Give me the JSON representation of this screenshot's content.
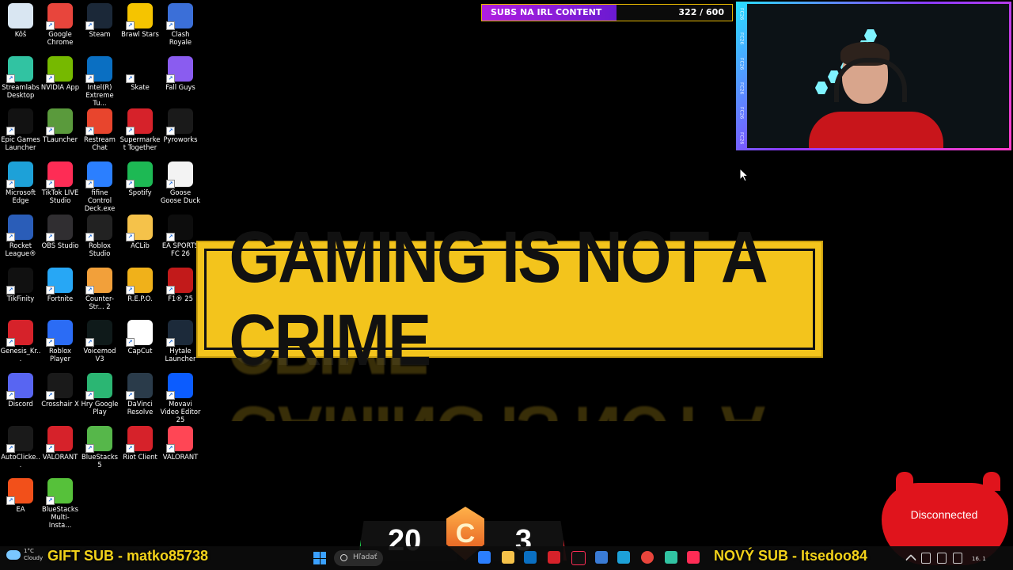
{
  "desktop": {
    "icons": [
      {
        "label": "Kôš",
        "icon": "recycle-bin-icon",
        "color": "#d9e6f2"
      },
      {
        "label": "Google Chrome",
        "icon": "chrome-icon",
        "color": "#e8453c"
      },
      {
        "label": "Steam",
        "icon": "steam-icon",
        "color": "#1b2838"
      },
      {
        "label": "Brawl Stars",
        "icon": "brawl-stars-icon",
        "color": "#f5c400"
      },
      {
        "label": "Clash Royale",
        "icon": "clash-royale-icon",
        "color": "#3b6fd8"
      },
      {
        "label": "Streamlabs Desktop",
        "icon": "streamlabs-icon",
        "color": "#31c3a2"
      },
      {
        "label": "NVIDIA App",
        "icon": "nvidia-icon",
        "color": "#76b900"
      },
      {
        "label": "Intel(R) Extreme Tu...",
        "icon": "intel-icon",
        "color": "#0a6fc2"
      },
      {
        "label": "Skate",
        "icon": "skate-icon",
        "color": "#000000"
      },
      {
        "label": "Fall Guys",
        "icon": "fall-guys-icon",
        "color": "#8a5cf0"
      },
      {
        "label": "Epic Games Launcher",
        "icon": "epic-games-icon",
        "color": "#121212"
      },
      {
        "label": "TLauncher",
        "icon": "tlauncher-icon",
        "color": "#5a9a3c"
      },
      {
        "label": "Restream Chat",
        "icon": "restream-icon",
        "color": "#e8452d"
      },
      {
        "label": "Supermarket Together",
        "icon": "supermarket-icon",
        "color": "#d6222a"
      },
      {
        "label": "Pyroworks",
        "icon": "pyroworks-icon",
        "color": "#1a1a1a"
      },
      {
        "label": "Microsoft Edge",
        "icon": "edge-icon",
        "color": "#1da1d8"
      },
      {
        "label": "TikTok LIVE Studio",
        "icon": "tiktok-live-icon",
        "color": "#fe2c55"
      },
      {
        "label": "fifine Control Deck.exe",
        "icon": "fifine-icon",
        "color": "#2b7fff"
      },
      {
        "label": "Spotify",
        "icon": "spotify-icon",
        "color": "#1db954"
      },
      {
        "label": "Goose Goose Duck",
        "icon": "goose-icon",
        "color": "#f3f3f3"
      },
      {
        "label": "Rocket League®",
        "icon": "rocket-league-icon",
        "color": "#2a5db8"
      },
      {
        "label": "OBS Studio",
        "icon": "obs-icon",
        "color": "#302e31"
      },
      {
        "label": "Roblox Studio",
        "icon": "roblox-studio-icon",
        "color": "#222222"
      },
      {
        "label": "ACLib",
        "icon": "folder-icon",
        "color": "#f5c24a"
      },
      {
        "label": "EA SPORTS FC 26",
        "icon": "fc26-icon",
        "color": "#0d0d0d"
      },
      {
        "label": "TikFinity",
        "icon": "tikfinity-icon",
        "color": "#111111"
      },
      {
        "label": "Fortnite",
        "icon": "fortnite-icon",
        "color": "#27a7f5"
      },
      {
        "label": "Counter-Str... 2",
        "icon": "cs2-icon",
        "color": "#f2a03a"
      },
      {
        "label": "R.E.P.O.",
        "icon": "repo-icon",
        "color": "#f0b11a"
      },
      {
        "label": "F1® 25",
        "icon": "f1-icon",
        "color": "#c21a1a"
      },
      {
        "label": "Genesis_Kr...",
        "icon": "genesis-icon",
        "color": "#d6222a"
      },
      {
        "label": "Roblox Player",
        "icon": "roblox-icon",
        "color": "#2b6cf5"
      },
      {
        "label": "Voicemod V3",
        "icon": "voicemod-icon",
        "color": "#0f1a1a"
      },
      {
        "label": "CapCut",
        "icon": "capcut-icon",
        "color": "#ffffff"
      },
      {
        "label": "Hytale Launcher",
        "icon": "hytale-icon",
        "color": "#1c2a3a"
      },
      {
        "label": "Discord",
        "icon": "discord-icon",
        "color": "#5865f2"
      },
      {
        "label": "Crosshair X",
        "icon": "crosshair-icon",
        "color": "#1a1a1a"
      },
      {
        "label": "Hry Google Play",
        "icon": "google-play-icon",
        "color": "#2bb673"
      },
      {
        "label": "DaVinci Resolve",
        "icon": "davinci-icon",
        "color": "#2a3b4a"
      },
      {
        "label": "Movavi Video Editor 25",
        "icon": "movavi-icon",
        "color": "#0b5cff"
      },
      {
        "label": "AutoClicke...",
        "icon": "mouse-icon",
        "color": "#1a1a1a"
      },
      {
        "label": "VALORANT",
        "icon": "valorant-riot-icon",
        "color": "#d6222a"
      },
      {
        "label": "BlueStacks 5",
        "icon": "bluestacks-icon",
        "color": "#56b74a"
      },
      {
        "label": "Riot Client",
        "icon": "riot-client-icon",
        "color": "#d6222a"
      },
      {
        "label": "VALORANT",
        "icon": "valorant-icon",
        "color": "#ff4655"
      },
      {
        "label": "EA",
        "icon": "ea-icon",
        "color": "#f2501a"
      },
      {
        "label": "BlueStacks Multi-Insta...",
        "icon": "bluestacks-multi-icon",
        "color": "#56c13a"
      }
    ]
  },
  "sub_goal": {
    "label": "SUBS NA IRL CONTENT",
    "current": 322,
    "target": 600,
    "text": "322 / 600",
    "progress": 0.537
  },
  "webcam": {
    "strip": [
      "FC26",
      "FC26",
      "FC26",
      "FC26",
      "FC26",
      "FC26"
    ]
  },
  "banner": {
    "text": "GAMING IS NOT A CRIME",
    "reflection": "GAMING IS NOT A CRIME"
  },
  "scoreboard": {
    "left": "20",
    "badge": "C",
    "right": "3"
  },
  "controller": {
    "status": "Disconnected"
  },
  "taskbar": {
    "weather_temp": "1°C",
    "weather_desc": "Cloudy",
    "gift_sub": "GIFT SUB - matko85738",
    "search_placeholder": "Hľadať",
    "new_sub": "NOVÝ SUB - Itsedoo84",
    "clock": "16. 1"
  }
}
